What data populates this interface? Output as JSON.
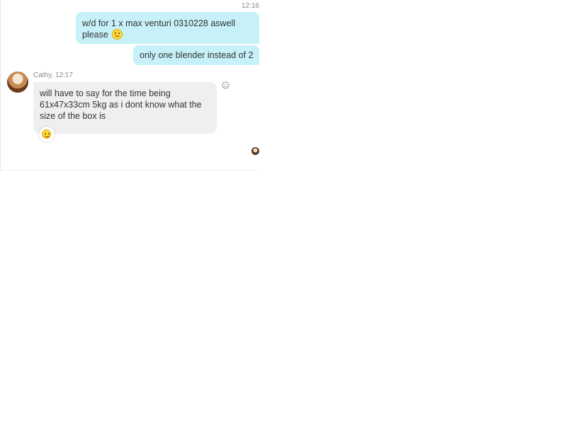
{
  "conversation": {
    "outgoing_time": "12:16",
    "messages": [
      {
        "text_line1": "w/d for 1 x max venturi 0310228 aswell",
        "text_line2": "please",
        "emoji": "smiling-face-emoji"
      },
      {
        "text": "only one blender instead of 2"
      }
    ],
    "incoming": {
      "sender": "Cathy",
      "time": "12:17",
      "line1": "will have to say  for the time being",
      "line2": "61x47x33cm  5kg  as i dont know what the",
      "line3": "size of the box is",
      "reaction_emoji": "smiling-face-emoji"
    }
  },
  "colors": {
    "outgoing_bubble": "#c7f1f8",
    "incoming_bubble": "#efefef",
    "text": "#333333",
    "meta_text": "#888888"
  }
}
